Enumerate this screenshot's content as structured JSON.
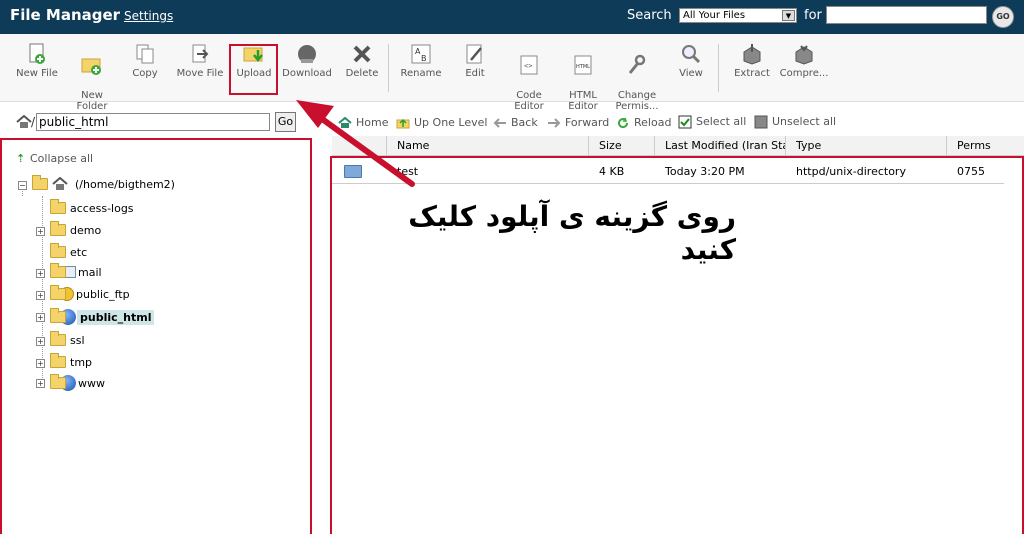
{
  "header": {
    "title": "File Manager",
    "settings_label": "Settings",
    "search_label": "Search",
    "search_scope": "All Your Files",
    "for_label": "for",
    "search_query": "",
    "go_label": "GO"
  },
  "toolbar": {
    "buttons": [
      {
        "label": "New File",
        "icon": "new-file-icon"
      },
      {
        "label": "New\nFolder",
        "icon": "new-folder-icon"
      },
      {
        "label": "Copy",
        "icon": "copy-icon"
      },
      {
        "label": "Move File",
        "icon": "move-file-icon"
      },
      {
        "label": "Upload",
        "icon": "upload-icon"
      },
      {
        "label": "Download",
        "icon": "download-icon"
      },
      {
        "label": "Delete",
        "icon": "delete-icon"
      },
      {
        "label": "Rename",
        "icon": "rename-icon"
      },
      {
        "label": "Edit",
        "icon": "edit-icon"
      },
      {
        "label": "Code\nEditor",
        "icon": "code-editor-icon"
      },
      {
        "label": "HTML\nEditor",
        "icon": "html-editor-icon"
      },
      {
        "label": "Change\nPermis...",
        "icon": "permissions-icon"
      },
      {
        "label": "View",
        "icon": "view-icon"
      },
      {
        "label": "Extract",
        "icon": "extract-icon"
      },
      {
        "label": "Compre...",
        "icon": "compress-icon"
      }
    ]
  },
  "pathbar": {
    "slash": "/",
    "path_value": "public_html",
    "go_label": "Go"
  },
  "tree": {
    "collapse_label": "Collapse all",
    "root_label": "(/home/bigthem2)",
    "items": [
      {
        "label": "access-logs",
        "expandable": false,
        "icon": "folder"
      },
      {
        "label": "demo",
        "expandable": true,
        "icon": "folder"
      },
      {
        "label": "etc",
        "expandable": false,
        "icon": "folder"
      },
      {
        "label": "mail",
        "expandable": true,
        "icon": "mail"
      },
      {
        "label": "public_ftp",
        "expandable": true,
        "icon": "ftp"
      },
      {
        "label": "public_html",
        "expandable": true,
        "icon": "globe",
        "selected": true
      },
      {
        "label": "ssl",
        "expandable": true,
        "icon": "folder"
      },
      {
        "label": "tmp",
        "expandable": true,
        "icon": "folder"
      },
      {
        "label": "www",
        "expandable": true,
        "icon": "globe"
      }
    ]
  },
  "nav": {
    "home": "Home",
    "up": "Up One Level",
    "back": "Back",
    "forward": "Forward",
    "reload": "Reload",
    "select_all": "Select all",
    "unselect_all": "Unselect all"
  },
  "table": {
    "columns": [
      "Name",
      "Size",
      "Last Modified (Iran Stand",
      "Type",
      "Perms"
    ],
    "rows": [
      {
        "name": "test",
        "size": "4 KB",
        "modified": "Today 3:20 PM",
        "type": "httpd/unix-directory",
        "perms": "0755"
      }
    ]
  },
  "annotation": {
    "instruction": "روی گزینه ی آپلود کلیک کنید",
    "highlight_color": "#c8102e"
  }
}
